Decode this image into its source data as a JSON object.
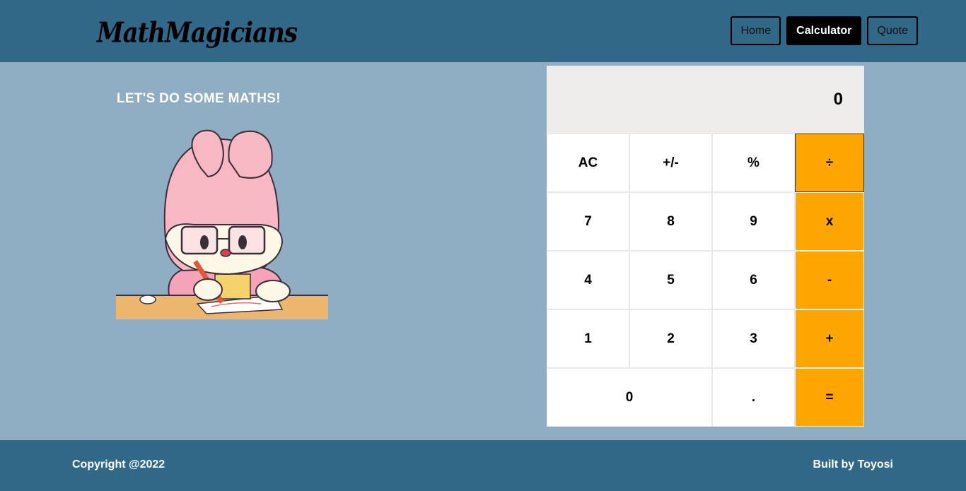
{
  "header": {
    "brand": "MathMagicians",
    "nav": [
      {
        "label": "Home",
        "active": false
      },
      {
        "label": "Calculator",
        "active": true
      },
      {
        "label": "Quote",
        "active": false
      }
    ]
  },
  "main": {
    "heading": "LET'S DO SOME MATHS!",
    "illustration_icon": "bunny-doing-math-illustration"
  },
  "calculator": {
    "display": "0",
    "keys": {
      "ac": "AC",
      "sign": "+/-",
      "percent": "%",
      "divide": "÷",
      "seven": "7",
      "eight": "8",
      "nine": "9",
      "multiply": "x",
      "four": "4",
      "five": "5",
      "six": "6",
      "minus": "-",
      "one": "1",
      "two": "2",
      "three": "3",
      "plus": "+",
      "zero": "0",
      "dot": ".",
      "equals": "="
    },
    "colors": {
      "operator": "#ffa500",
      "display_bg": "#efedeb"
    }
  },
  "footer": {
    "copyright": "Copyright @2022",
    "credit": "Built by Toyosi"
  },
  "colors": {
    "navbar": "#316888",
    "page_bg": "#8fadc3"
  }
}
